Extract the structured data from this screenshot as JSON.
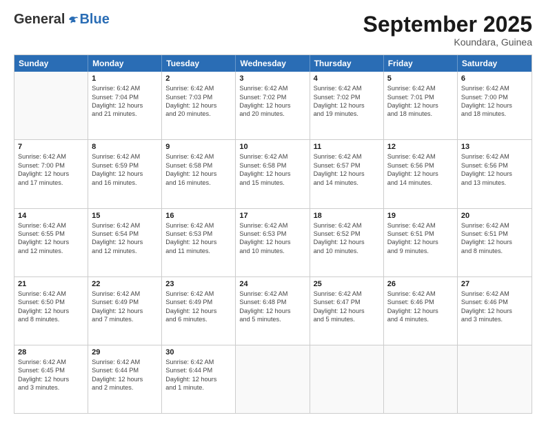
{
  "header": {
    "logo_general": "General",
    "logo_blue": "Blue",
    "month_title": "September 2025",
    "location": "Koundara, Guinea"
  },
  "weekdays": [
    "Sunday",
    "Monday",
    "Tuesday",
    "Wednesday",
    "Thursday",
    "Friday",
    "Saturday"
  ],
  "rows": [
    [
      {
        "day": "",
        "info": ""
      },
      {
        "day": "1",
        "info": "Sunrise: 6:42 AM\nSunset: 7:04 PM\nDaylight: 12 hours\nand 21 minutes."
      },
      {
        "day": "2",
        "info": "Sunrise: 6:42 AM\nSunset: 7:03 PM\nDaylight: 12 hours\nand 20 minutes."
      },
      {
        "day": "3",
        "info": "Sunrise: 6:42 AM\nSunset: 7:02 PM\nDaylight: 12 hours\nand 20 minutes."
      },
      {
        "day": "4",
        "info": "Sunrise: 6:42 AM\nSunset: 7:02 PM\nDaylight: 12 hours\nand 19 minutes."
      },
      {
        "day": "5",
        "info": "Sunrise: 6:42 AM\nSunset: 7:01 PM\nDaylight: 12 hours\nand 18 minutes."
      },
      {
        "day": "6",
        "info": "Sunrise: 6:42 AM\nSunset: 7:00 PM\nDaylight: 12 hours\nand 18 minutes."
      }
    ],
    [
      {
        "day": "7",
        "info": "Sunrise: 6:42 AM\nSunset: 7:00 PM\nDaylight: 12 hours\nand 17 minutes."
      },
      {
        "day": "8",
        "info": "Sunrise: 6:42 AM\nSunset: 6:59 PM\nDaylight: 12 hours\nand 16 minutes."
      },
      {
        "day": "9",
        "info": "Sunrise: 6:42 AM\nSunset: 6:58 PM\nDaylight: 12 hours\nand 16 minutes."
      },
      {
        "day": "10",
        "info": "Sunrise: 6:42 AM\nSunset: 6:58 PM\nDaylight: 12 hours\nand 15 minutes."
      },
      {
        "day": "11",
        "info": "Sunrise: 6:42 AM\nSunset: 6:57 PM\nDaylight: 12 hours\nand 14 minutes."
      },
      {
        "day": "12",
        "info": "Sunrise: 6:42 AM\nSunset: 6:56 PM\nDaylight: 12 hours\nand 14 minutes."
      },
      {
        "day": "13",
        "info": "Sunrise: 6:42 AM\nSunset: 6:56 PM\nDaylight: 12 hours\nand 13 minutes."
      }
    ],
    [
      {
        "day": "14",
        "info": "Sunrise: 6:42 AM\nSunset: 6:55 PM\nDaylight: 12 hours\nand 12 minutes."
      },
      {
        "day": "15",
        "info": "Sunrise: 6:42 AM\nSunset: 6:54 PM\nDaylight: 12 hours\nand 12 minutes."
      },
      {
        "day": "16",
        "info": "Sunrise: 6:42 AM\nSunset: 6:53 PM\nDaylight: 12 hours\nand 11 minutes."
      },
      {
        "day": "17",
        "info": "Sunrise: 6:42 AM\nSunset: 6:53 PM\nDaylight: 12 hours\nand 10 minutes."
      },
      {
        "day": "18",
        "info": "Sunrise: 6:42 AM\nSunset: 6:52 PM\nDaylight: 12 hours\nand 10 minutes."
      },
      {
        "day": "19",
        "info": "Sunrise: 6:42 AM\nSunset: 6:51 PM\nDaylight: 12 hours\nand 9 minutes."
      },
      {
        "day": "20",
        "info": "Sunrise: 6:42 AM\nSunset: 6:51 PM\nDaylight: 12 hours\nand 8 minutes."
      }
    ],
    [
      {
        "day": "21",
        "info": "Sunrise: 6:42 AM\nSunset: 6:50 PM\nDaylight: 12 hours\nand 8 minutes."
      },
      {
        "day": "22",
        "info": "Sunrise: 6:42 AM\nSunset: 6:49 PM\nDaylight: 12 hours\nand 7 minutes."
      },
      {
        "day": "23",
        "info": "Sunrise: 6:42 AM\nSunset: 6:49 PM\nDaylight: 12 hours\nand 6 minutes."
      },
      {
        "day": "24",
        "info": "Sunrise: 6:42 AM\nSunset: 6:48 PM\nDaylight: 12 hours\nand 5 minutes."
      },
      {
        "day": "25",
        "info": "Sunrise: 6:42 AM\nSunset: 6:47 PM\nDaylight: 12 hours\nand 5 minutes."
      },
      {
        "day": "26",
        "info": "Sunrise: 6:42 AM\nSunset: 6:46 PM\nDaylight: 12 hours\nand 4 minutes."
      },
      {
        "day": "27",
        "info": "Sunrise: 6:42 AM\nSunset: 6:46 PM\nDaylight: 12 hours\nand 3 minutes."
      }
    ],
    [
      {
        "day": "28",
        "info": "Sunrise: 6:42 AM\nSunset: 6:45 PM\nDaylight: 12 hours\nand 3 minutes."
      },
      {
        "day": "29",
        "info": "Sunrise: 6:42 AM\nSunset: 6:44 PM\nDaylight: 12 hours\nand 2 minutes."
      },
      {
        "day": "30",
        "info": "Sunrise: 6:42 AM\nSunset: 6:44 PM\nDaylight: 12 hours\nand 1 minute."
      },
      {
        "day": "",
        "info": ""
      },
      {
        "day": "",
        "info": ""
      },
      {
        "day": "",
        "info": ""
      },
      {
        "day": "",
        "info": ""
      }
    ]
  ]
}
